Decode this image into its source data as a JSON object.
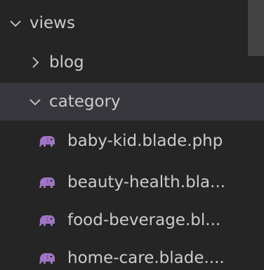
{
  "explorer": {
    "root": {
      "label": "views",
      "expanded": true
    },
    "items": [
      {
        "label": "blog",
        "type": "folder",
        "expanded": false
      },
      {
        "label": "category",
        "type": "folder",
        "expanded": true
      },
      {
        "label": "baby-kid.blade.php",
        "type": "file",
        "icon": "php-elephant-icon"
      },
      {
        "label": "beauty-health.bla...",
        "type": "file",
        "icon": "php-elephant-icon"
      },
      {
        "label": "food-beverage.bl...",
        "type": "file",
        "icon": "php-elephant-icon"
      },
      {
        "label": "home-care.blade....",
        "type": "file",
        "icon": "php-elephant-icon"
      }
    ]
  },
  "colors": {
    "background": "#252526",
    "selected_row": "#37373d",
    "text": "#cccccc",
    "php_icon": "#a074c4"
  }
}
